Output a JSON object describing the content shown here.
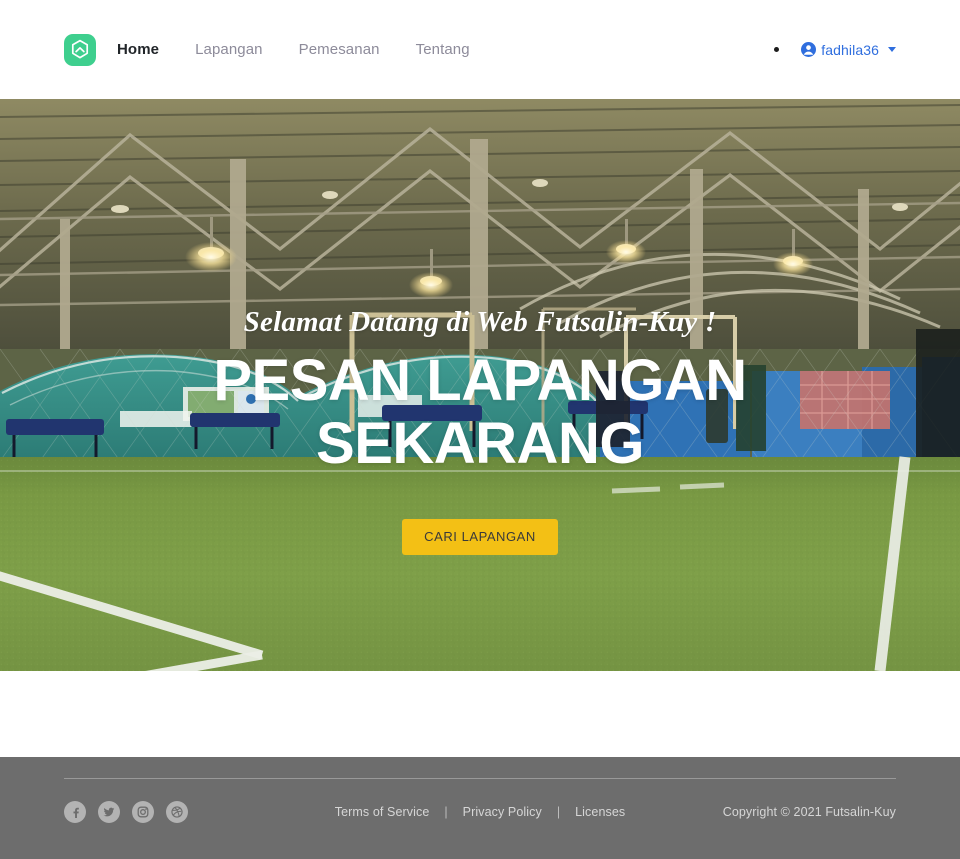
{
  "navbar": {
    "logo_icon": "hexagon-logo-icon",
    "logo_color": "#3ecf8e",
    "links": [
      {
        "label": "Home",
        "state": "active"
      },
      {
        "label": "Lapangan",
        "state": "inactive"
      },
      {
        "label": "Pemesanan",
        "state": "inactive"
      },
      {
        "label": "Tentang",
        "state": "inactive"
      }
    ],
    "user": {
      "name": "fadhila36",
      "icon": "user-circle-icon",
      "color": "#2f6ede",
      "caret": "chevron-down-icon"
    }
  },
  "hero": {
    "welcome": "Selamat Datang di Web Futsalin-Kuy !",
    "title_line1": "PESAN LAPANGAN",
    "title_line2": "SEKARANG",
    "cta_label": "CARI LAPANGAN",
    "cta_color": "#f3c015",
    "background": "indoor-futsal-court-photo"
  },
  "footer": {
    "background_color": "#6d6d6d",
    "social": [
      {
        "name": "facebook",
        "glyph": "f"
      },
      {
        "name": "twitter",
        "glyph": "bird"
      },
      {
        "name": "instagram",
        "glyph": "camera"
      },
      {
        "name": "dribbble",
        "glyph": "ball"
      }
    ],
    "links": [
      {
        "label": "Terms of Service"
      },
      {
        "label": "Privacy Policy"
      },
      {
        "label": "Licenses"
      }
    ],
    "separator": "|",
    "copyright": "Copyright © 2021 Futsalin-Kuy"
  }
}
